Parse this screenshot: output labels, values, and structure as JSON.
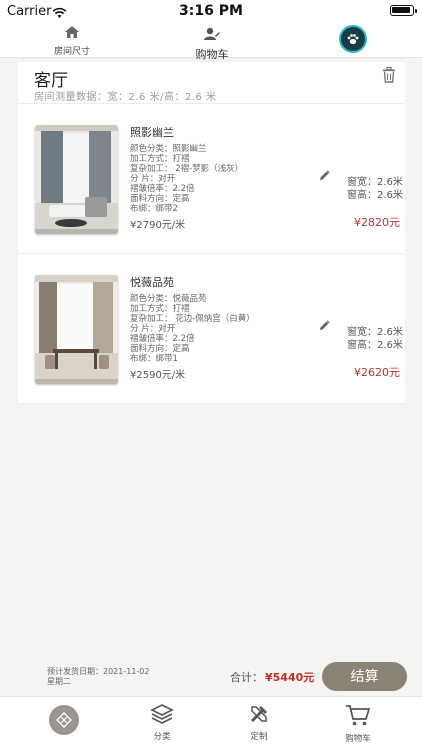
{
  "status_bar": {
    "carrier": "Carrier",
    "time": "3:16 PM"
  },
  "top_nav": {
    "room_size_label": "房间尺寸",
    "cart_label": "购物车"
  },
  "room": {
    "title": "客厅",
    "measure_text": "房间测量数据：宽：2.6 米/高：2.6 米"
  },
  "products": [
    {
      "name": "照影幽兰",
      "specs": [
        "颜色分类：照影幽兰",
        "加工方式：打褶",
        "复杂加工：  2褶-梦影（浅灰）",
        "分 片：对开",
        "褶皱倍率：2.2倍",
        "面料方向：定高",
        "布绑：绑带2"
      ],
      "window_width": "窗宽：2.6米",
      "window_height": "窗高：2.6米",
      "unit_price": "¥2790元/米",
      "total_price": "¥2820元"
    },
    {
      "name": "悦薇品苑",
      "specs": [
        "颜色分类：悦薇品苑",
        "加工方式：打褶",
        "复杂加工：  花边-佩纳宫（白黄）",
        "分 片：对开",
        "褶皱倍率：2.2倍",
        "面料方向：定高",
        "布绑：绑带1"
      ],
      "window_width": "窗宽：2.6米",
      "window_height": "窗高：2.6米",
      "unit_price": "¥2590元/米",
      "total_price": "¥2620元"
    }
  ],
  "summary": {
    "ship_date": "预计发货日期：2021-11-02",
    "weekday": "星期二",
    "total_label": "合计：",
    "total_value": "¥5440元",
    "checkout_label": "结算"
  },
  "tab_bar": {
    "tabs": [
      {
        "label": ""
      },
      {
        "label": "分类"
      },
      {
        "label": "定制"
      },
      {
        "label": "购物车"
      }
    ]
  },
  "colors": {
    "accent": "#8a8274",
    "price_red": "#c0302c",
    "background": "#f5f4f2"
  },
  "icons": [
    "wifi-icon",
    "battery-icon",
    "home-icon",
    "user-edit-icon",
    "avatar",
    "trash-icon",
    "edit-pencil-icon",
    "logo-icon",
    "layers-icon",
    "tools-icon",
    "cart-icon"
  ]
}
